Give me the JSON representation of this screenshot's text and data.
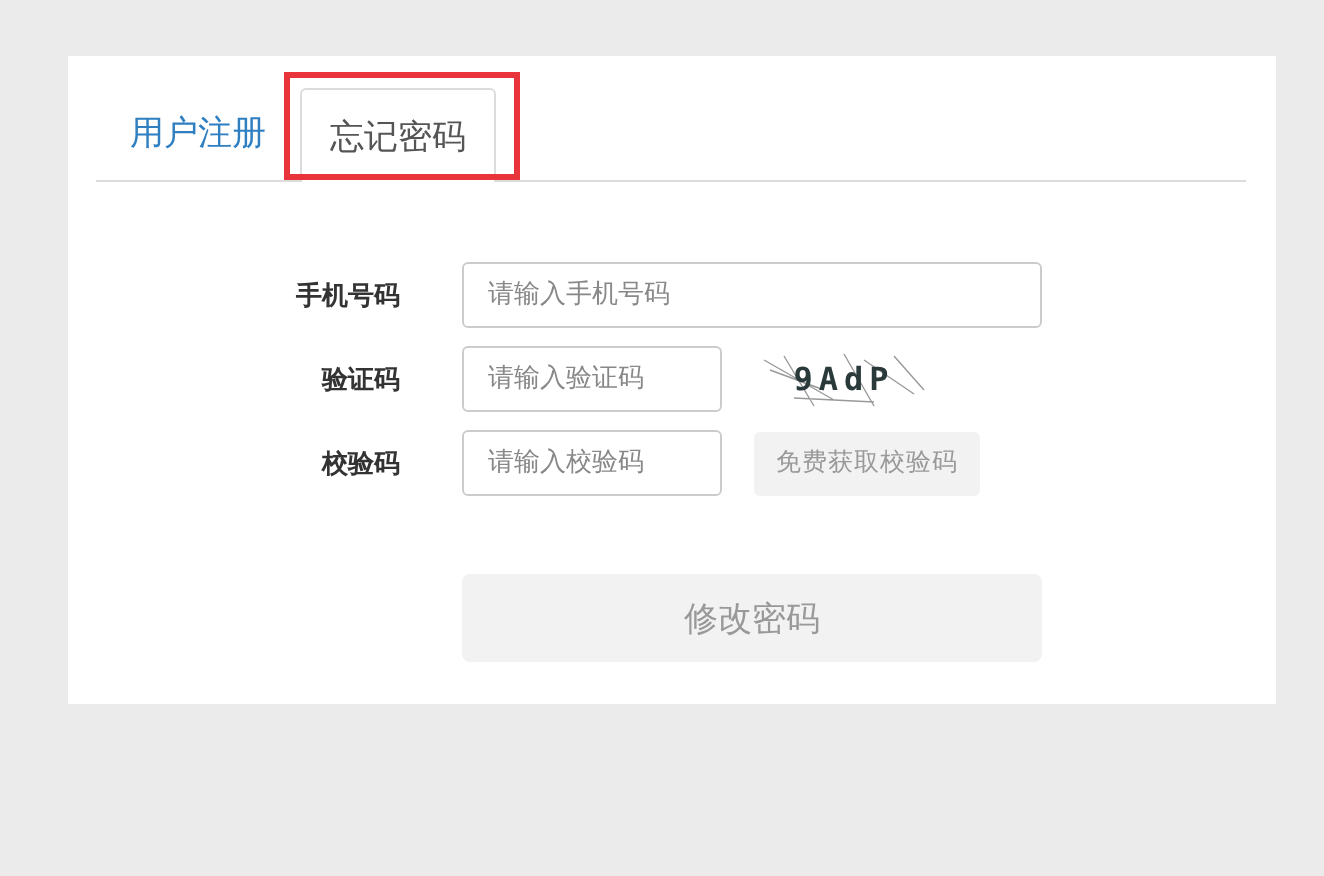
{
  "tabs": [
    {
      "label": "用户注册",
      "selected": false,
      "highlighted": false
    },
    {
      "label": "忘记密码",
      "selected": true,
      "highlighted": true
    }
  ],
  "form": {
    "fields": [
      {
        "label": "手机号码",
        "placeholder": "请输入手机号码",
        "kind": "wide"
      },
      {
        "label": "验证码",
        "placeholder": "请输入验证码",
        "kind": "captcha",
        "captcha": "9AdP"
      },
      {
        "label": "校验码",
        "placeholder": "请输入校验码",
        "kind": "sms",
        "button": "免费获取校验码"
      }
    ],
    "submit": {
      "label": "修改密码",
      "disabled": true
    }
  }
}
